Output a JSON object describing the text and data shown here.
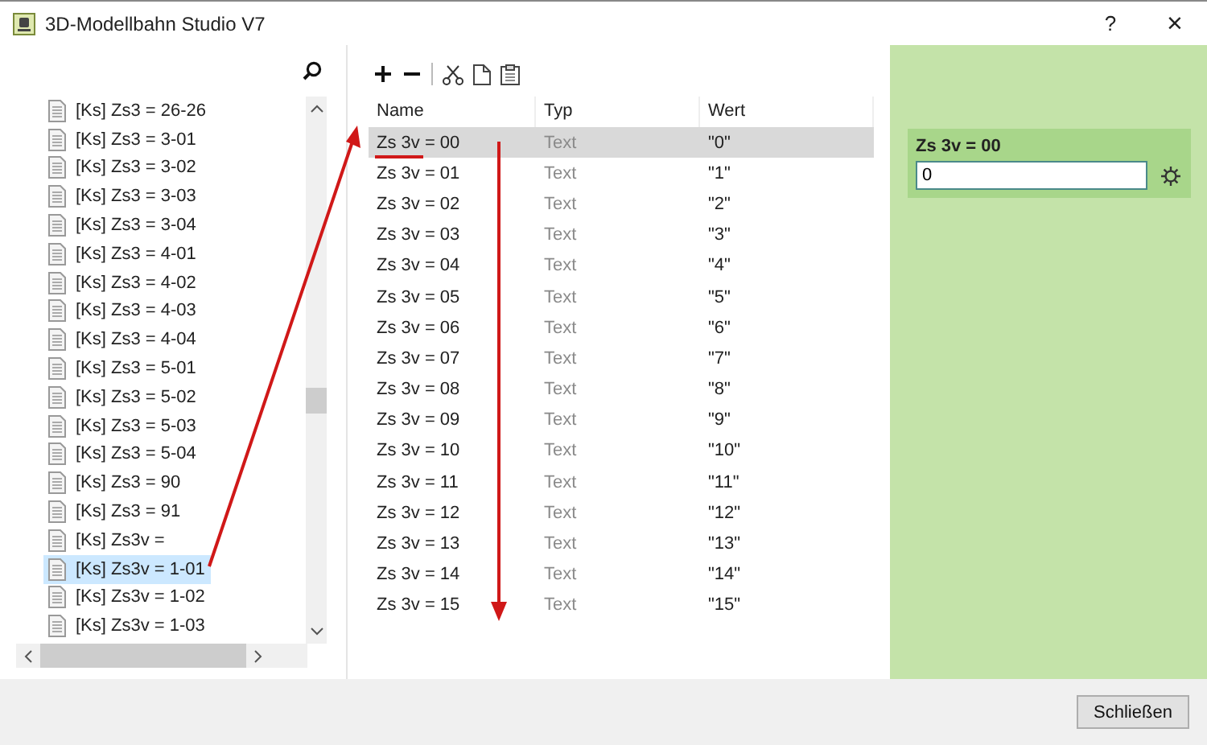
{
  "window": {
    "title": "3D-Modellbahn Studio V7",
    "help": "?",
    "close": "×"
  },
  "tree": {
    "items": [
      {
        "label": "[Ks] Zs3 = 26-26",
        "selected": false
      },
      {
        "label": "[Ks] Zs3 = 3-01",
        "selected": false
      },
      {
        "label": "[Ks] Zs3 = 3-02",
        "selected": false
      },
      {
        "label": "[Ks] Zs3 = 3-03",
        "selected": false
      },
      {
        "label": "[Ks] Zs3 = 3-04",
        "selected": false
      },
      {
        "label": "[Ks] Zs3 = 4-01",
        "selected": false
      },
      {
        "label": "[Ks] Zs3 = 4-02",
        "selected": false
      },
      {
        "label": "[Ks] Zs3 = 4-03",
        "selected": false
      },
      {
        "label": "[Ks] Zs3 = 4-04",
        "selected": false
      },
      {
        "label": "[Ks] Zs3 = 5-01",
        "selected": false
      },
      {
        "label": "[Ks] Zs3 = 5-02",
        "selected": false
      },
      {
        "label": "[Ks] Zs3 = 5-03",
        "selected": false
      },
      {
        "label": "[Ks] Zs3 = 5-04",
        "selected": false
      },
      {
        "label": "[Ks] Zs3 = 90",
        "selected": false
      },
      {
        "label": "[Ks] Zs3 = 91",
        "selected": false
      },
      {
        "label": "[Ks] Zs3v =",
        "selected": false
      },
      {
        "label": "[Ks] Zs3v = 1-01",
        "selected": true
      },
      {
        "label": "[Ks] Zs3v = 1-02",
        "selected": false
      },
      {
        "label": "[Ks] Zs3v = 1-03",
        "selected": false
      }
    ]
  },
  "table": {
    "columns": [
      "Name",
      "Typ",
      "Wert"
    ],
    "rows": [
      {
        "name": "Zs 3v = 00",
        "type": "Text",
        "value": "\"0\"",
        "selected": true
      },
      {
        "name": "Zs 3v = 01",
        "type": "Text",
        "value": "\"1\"",
        "selected": false
      },
      {
        "name": "Zs 3v = 02",
        "type": "Text",
        "value": "\"2\"",
        "selected": false
      },
      {
        "name": "Zs 3v = 03",
        "type": "Text",
        "value": "\"3\"",
        "selected": false
      },
      {
        "name": "Zs 3v = 04",
        "type": "Text",
        "value": "\"4\"",
        "selected": false
      },
      {
        "name": "Zs 3v = 05",
        "type": "Text",
        "value": "\"5\"",
        "selected": false
      },
      {
        "name": "Zs 3v = 06",
        "type": "Text",
        "value": "\"6\"",
        "selected": false
      },
      {
        "name": "Zs 3v = 07",
        "type": "Text",
        "value": "\"7\"",
        "selected": false
      },
      {
        "name": "Zs 3v = 08",
        "type": "Text",
        "value": "\"8\"",
        "selected": false
      },
      {
        "name": "Zs 3v = 09",
        "type": "Text",
        "value": "\"9\"",
        "selected": false
      },
      {
        "name": "Zs 3v = 10",
        "type": "Text",
        "value": "\"10\"",
        "selected": false
      },
      {
        "name": "Zs 3v = 11",
        "type": "Text",
        "value": "\"11\"",
        "selected": false
      },
      {
        "name": "Zs 3v = 12",
        "type": "Text",
        "value": "\"12\"",
        "selected": false
      },
      {
        "name": "Zs 3v = 13",
        "type": "Text",
        "value": "\"13\"",
        "selected": false
      },
      {
        "name": "Zs 3v = 14",
        "type": "Text",
        "value": "\"14\"",
        "selected": false
      },
      {
        "name": "Zs 3v = 15",
        "type": "Text",
        "value": "\"15\"",
        "selected": false
      }
    ]
  },
  "property": {
    "title": "Zs 3v = 00",
    "value": "0"
  },
  "buttons": [
    "Schließen"
  ]
}
